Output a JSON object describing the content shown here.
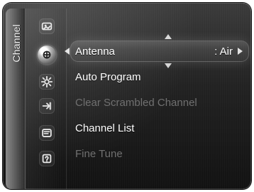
{
  "side_tab": {
    "label": "Channel"
  },
  "rail": {
    "icons": [
      {
        "name": "picture-icon"
      },
      {
        "name": "channel-icon"
      },
      {
        "name": "settings-icon"
      },
      {
        "name": "input-icon"
      },
      {
        "name": "application-icon"
      },
      {
        "name": "support-icon"
      }
    ]
  },
  "menu": {
    "items": [
      {
        "label": "Antenna",
        "value": ": Air",
        "state": "selected"
      },
      {
        "label": "Auto Program",
        "state": "normal"
      },
      {
        "label": "Clear Scrambled Channel",
        "state": "disabled"
      },
      {
        "label": "Channel List",
        "state": "normal"
      },
      {
        "label": "Fine Tune",
        "state": "disabled"
      }
    ]
  }
}
